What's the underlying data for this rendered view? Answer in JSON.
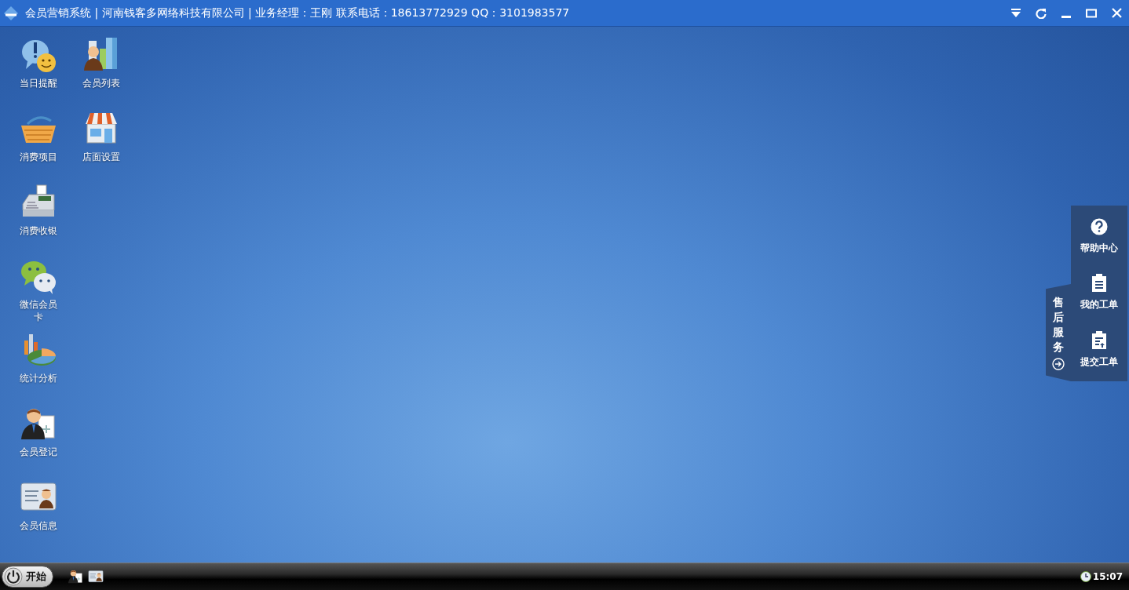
{
  "window": {
    "title": "会员营销系统 | 河南钱客多网络科技有限公司 | 业务经理：王刚 联系电话：18613772929 QQ：3101983577"
  },
  "desktop": {
    "columns": [
      [
        {
          "label": "当日提醒"
        },
        {
          "label": "消费项目"
        },
        {
          "label": "消费收银"
        },
        {
          "label": "微信会员卡"
        },
        {
          "label": "统计分析"
        },
        {
          "label": "会员登记"
        },
        {
          "label": "会员信息"
        }
      ],
      [
        {
          "label": "会员列表"
        },
        {
          "label": "店面设置"
        }
      ]
    ]
  },
  "service_panel": {
    "tab": "售后服务",
    "items": [
      {
        "label": "帮助中心"
      },
      {
        "label": "我的工单"
      },
      {
        "label": "提交工单"
      }
    ]
  },
  "taskbar": {
    "start": "开始",
    "clock": "15:07"
  }
}
